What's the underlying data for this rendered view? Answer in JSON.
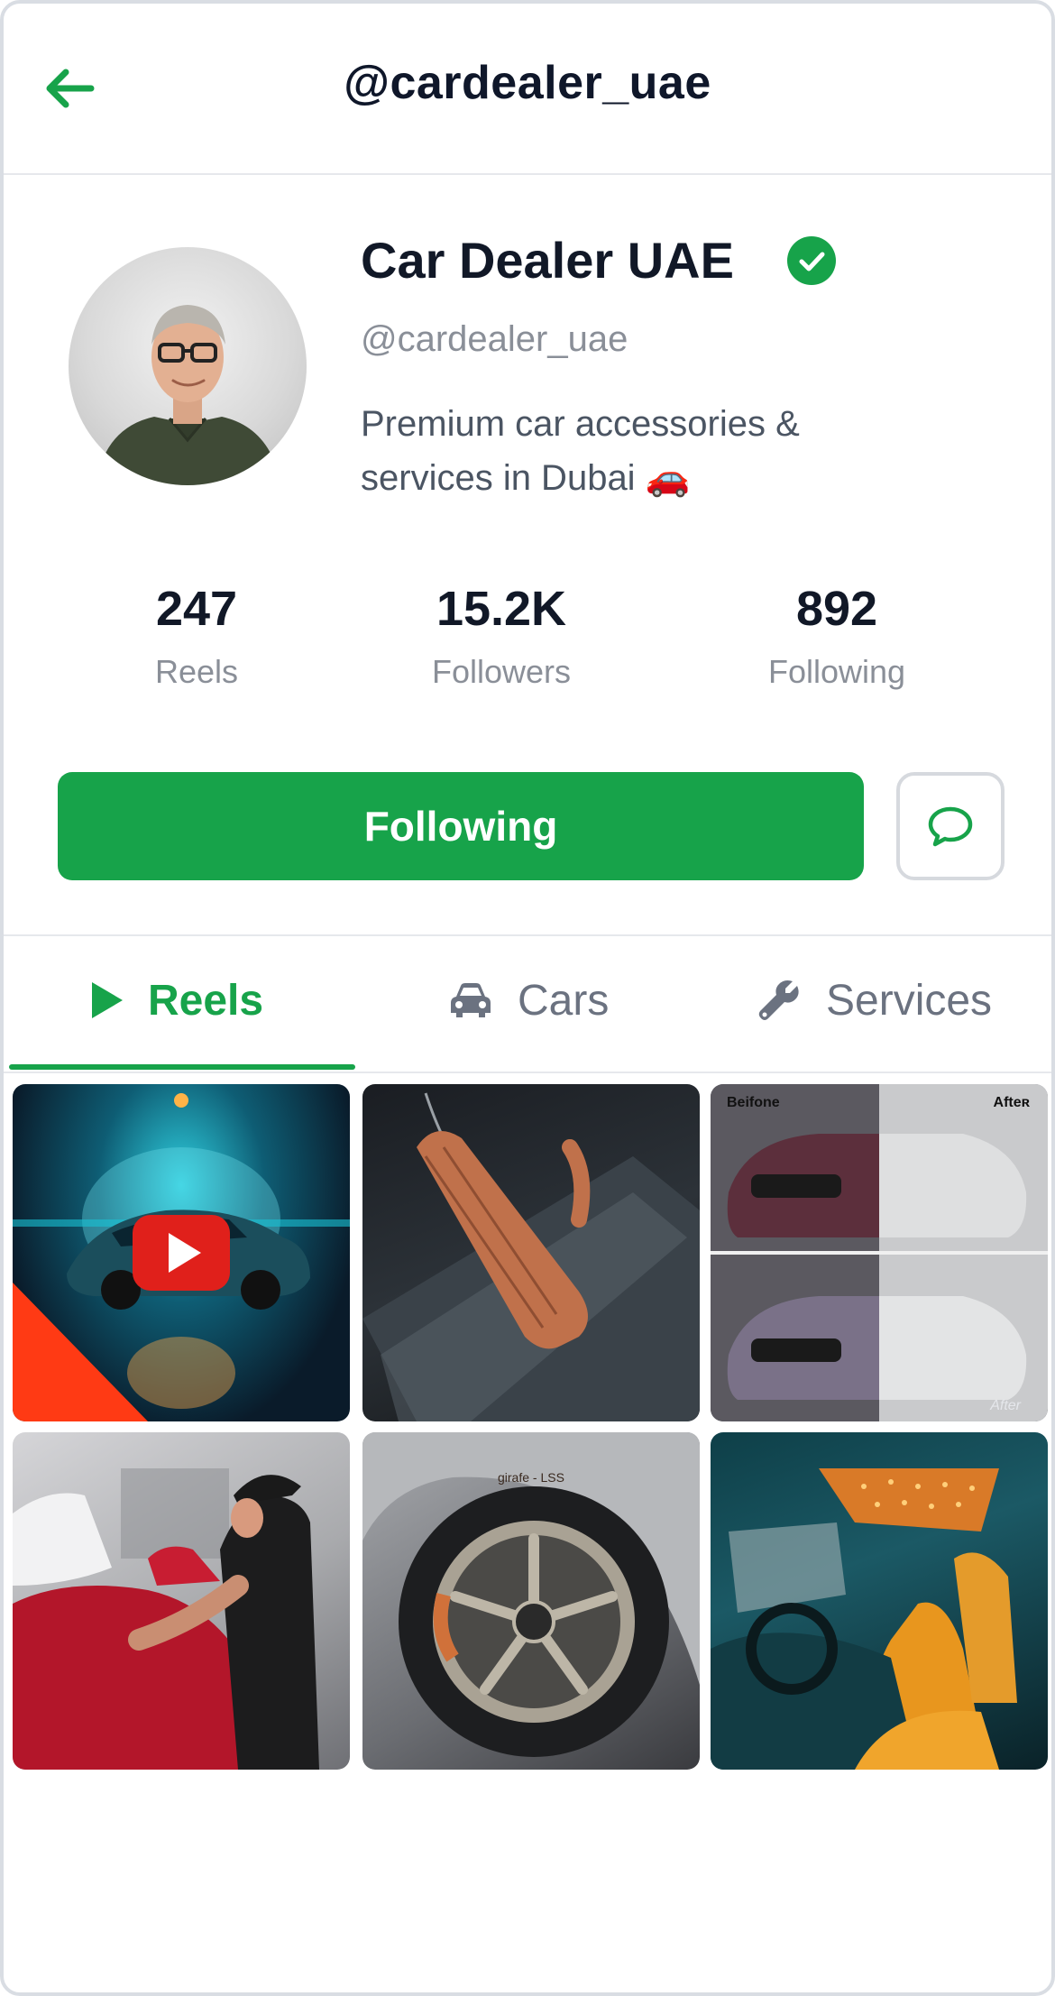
{
  "header": {
    "title": "@cardealer_uae",
    "back_icon": "arrow-left-icon"
  },
  "profile": {
    "name": "Car Dealer UAE",
    "handle": "@cardealer_uae",
    "bio_line1": "Premium car accessories &",
    "bio_line2": "services in Dubai 🚗",
    "verified": true
  },
  "stats": [
    {
      "value": "247",
      "label": "Reels"
    },
    {
      "value": "15.2K",
      "label": "Followers"
    },
    {
      "value": "892",
      "label": "Following"
    }
  ],
  "actions": {
    "follow_label": "Following",
    "message_icon": "chat-bubble-icon"
  },
  "tabs": [
    {
      "label": "Reels",
      "icon": "play-icon",
      "active": true
    },
    {
      "label": "Cars",
      "icon": "car-icon",
      "active": false
    },
    {
      "label": "Services",
      "icon": "wrench-icon",
      "active": false
    }
  ],
  "grid": {
    "tiles": [
      {
        "name": "reel-sports-car-showroom",
        "has_play_icon": true
      },
      {
        "name": "reel-leather-accessory"
      },
      {
        "name": "reel-before-after-wrap",
        "before_label": "Beifone",
        "after_label_top": "Afteʀ",
        "after_label_bottom": "After"
      },
      {
        "name": "reel-paint-polishing"
      },
      {
        "name": "reel-alloy-wheel",
        "tire_text": "girafe - LSS"
      },
      {
        "name": "reel-orange-interior"
      }
    ]
  },
  "colors": {
    "accent": "#17a34a",
    "text_primary": "#111827",
    "text_secondary": "#8a8f98",
    "border": "#e6e8ec"
  }
}
